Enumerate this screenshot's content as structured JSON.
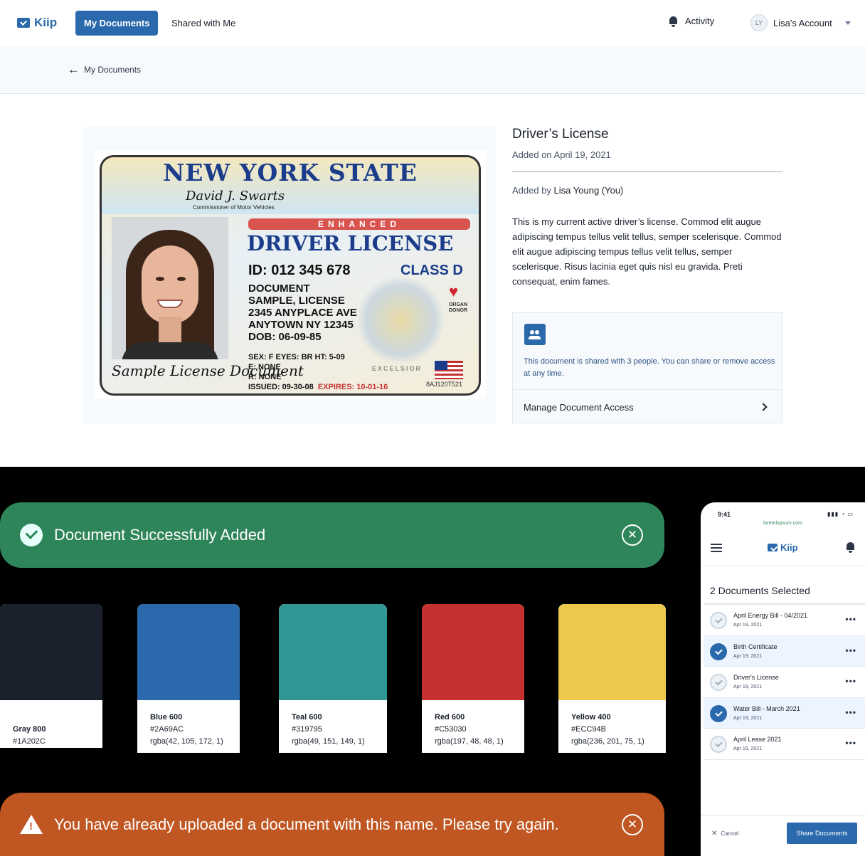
{
  "nav": {
    "logo": "Kiip",
    "tabs": [
      "My Documents",
      "Shared with Me"
    ],
    "activity": "Activity",
    "avatar_initials": "LY",
    "account": "Lisa's Account"
  },
  "breadcrumb": {
    "back_label": "My Documents"
  },
  "license_card": {
    "state": "NEW YORK STATE",
    "commissioner": "Commissioner of Motor Vehicles",
    "commissioner_signature": "David J. Swarts",
    "enhanced": "ENHANCED",
    "title": "DRIVER LICENSE",
    "id_line": "ID: 012 345 678",
    "class": "CLASS D",
    "line1": "DOCUMENT",
    "line2": "SAMPLE, LICENSE",
    "line3": "2345 ANYPLACE AVE",
    "line4": "ANYTOWN NY  12345",
    "line5": "DOB:  06-09-85",
    "sex_eyes_ht": "SEX: F   EYES: BR   HT: 5-09",
    "e_none": "E: NONE",
    "r_none": "R: NONE",
    "issued": "ISSUED: 09-30-08",
    "expires": "EXPIRES: 10-01-16",
    "organ_donor": "ORGAN DONOR",
    "seal_motto": "EXCELSIOR",
    "serial": "8AJ120T521",
    "signature": "Sample License Document"
  },
  "document": {
    "title": "Driver’s License",
    "added_on": "Added on April 19, 2021",
    "added_by_prefix": "Added by ",
    "added_by_name": "Lisa Young (You)",
    "description": "This is my current active driver’s license. Commod elit augue adipiscing tempus tellus velit tellus, semper scelerisque. Commod elit augue adipiscing tempus tellus velit tellus, semper scelerisque. Risus lacinia eget quis nisl eu gravida. Preti consequat, enim fames.",
    "share_text": "This document is shared with 3 people. You can share or remove access at any time.",
    "manage_label": "Manage Document Access"
  },
  "toasts": {
    "success": "Document Successfully Added",
    "error": "You have already uploaded a document with this name. Please try again.",
    "close_glyph": "✕"
  },
  "swatches": [
    {
      "name": "Gray 800",
      "hex": "#1A202C",
      "rgba": "",
      "color": "#1A202C"
    },
    {
      "name": "Blue 600",
      "hex": "#2A69AC",
      "rgba": "rgba(42, 105, 172, 1)",
      "color": "#2A69AC"
    },
    {
      "name": "Teal 600",
      "hex": "#319795",
      "rgba": "rgba(49, 151, 149, 1)",
      "color": "#319795"
    },
    {
      "name": "Red 600",
      "hex": "#C53030",
      "rgba": "rgba(197, 48, 48, 1)",
      "color": "#C53030"
    },
    {
      "name": "Yellow 400",
      "hex": "#ECC94B",
      "rgba": "rgba(236, 201, 75, 1)",
      "color": "#ECC94B"
    }
  ],
  "phone": {
    "time": "9:41",
    "status_icons": "▮▮▮ ◔ ▭",
    "url": "loremispsum.com",
    "logo": "Kiip",
    "selected_count": "2 Documents Selected",
    "items": [
      {
        "name": "April Energy Bill - 04/2021",
        "date": "Apr 19, 2021",
        "selected": false
      },
      {
        "name": "Birth Certificate",
        "date": "Apr 19, 2021",
        "selected": true
      },
      {
        "name": "Driver's License",
        "date": "Apr 19, 2021",
        "selected": false
      },
      {
        "name": "Water Bill - March 2021",
        "date": "Apr 19, 2021",
        "selected": true
      },
      {
        "name": "April Lease 2021",
        "date": "Apr 19, 2021",
        "selected": false
      }
    ],
    "more_glyph": "•••",
    "cancel": "Cancel",
    "share": "Share Documents"
  }
}
